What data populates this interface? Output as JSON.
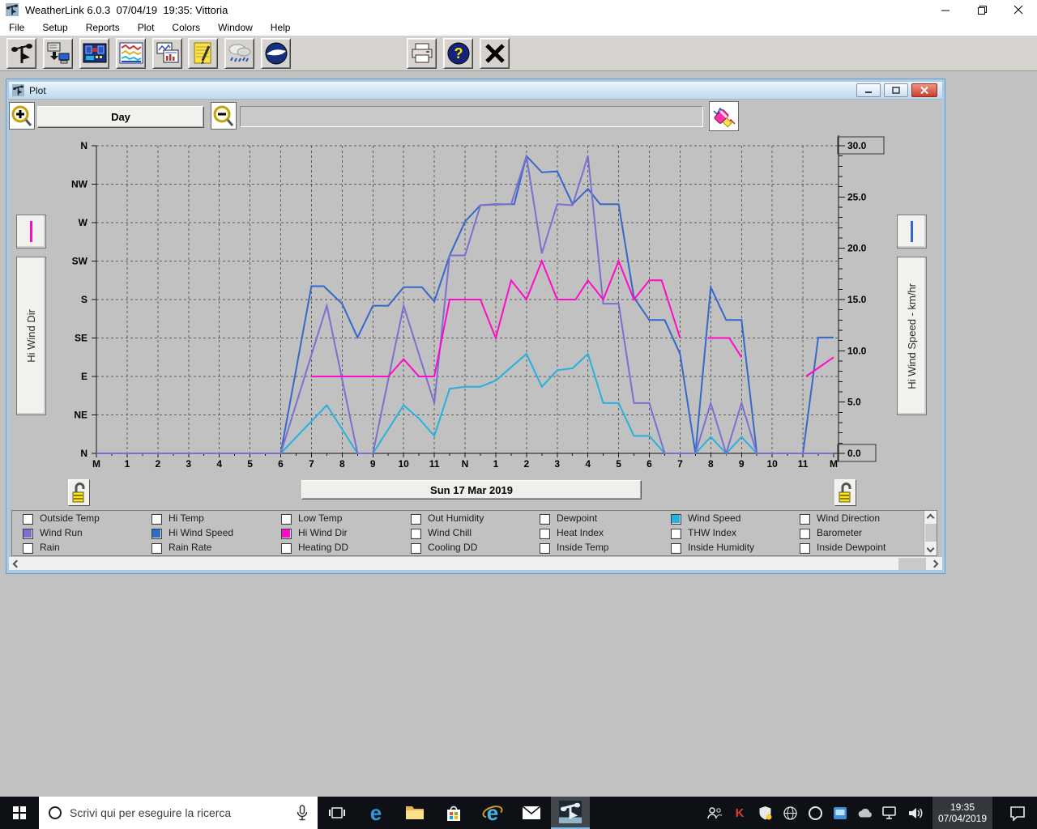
{
  "app": {
    "title": "WeatherLink 6.0.3  07/04/19  19:35: Vittoria",
    "menu": [
      "File",
      "Setup",
      "Reports",
      "Plot",
      "Colors",
      "Window",
      "Help"
    ]
  },
  "toolbar": {
    "icons": [
      "station",
      "download",
      "bulletin",
      "plot",
      "strip-charts",
      "notes",
      "rain",
      "noaa",
      "print",
      "help",
      "close"
    ],
    "help_glyph": "?"
  },
  "plot_window": {
    "title": "Plot",
    "range_button": "Day",
    "date_button": "Sun 17 Mar 2019",
    "left_axis_panel": "Hi Wind Dir",
    "right_axis_panel": "Hi Wind Speed - km/hr"
  },
  "chart_data": {
    "type": "line",
    "title": "Day plot - Sun 17 Mar 2019",
    "grid": "dashed",
    "x": {
      "unit": "hour",
      "min": 0,
      "max": 24,
      "tick_labels": [
        "M",
        "1",
        "2",
        "3",
        "4",
        "5",
        "6",
        "7",
        "8",
        "9",
        "10",
        "11",
        "N",
        "1",
        "2",
        "3",
        "4",
        "5",
        "6",
        "7",
        "8",
        "9",
        "10",
        "11",
        "M"
      ]
    },
    "left_axis": {
      "title": "Hi Wind Dir",
      "labels_bottom_to_top": [
        "N",
        "NE",
        "E",
        "SE",
        "S",
        "SW",
        "W",
        "NW",
        "N"
      ]
    },
    "right_axis": {
      "title": "Hi Wind Speed - km/hr",
      "min": 0,
      "max": 30,
      "major_step": 5,
      "labels": [
        "0.0",
        "5.0",
        "10.0",
        "15.0",
        "20.0",
        "25.0",
        "30.0"
      ],
      "boxed_labels": [
        "30.0",
        "0.0"
      ]
    },
    "series": [
      {
        "name": "Hi Wind Speed",
        "axis": "right",
        "color": "#3568c8",
        "segments": [
          [
            [
              0,
              0
            ],
            [
              6,
              0
            ],
            [
              7,
              16.3
            ],
            [
              7.4,
              16.3
            ],
            [
              8,
              14.6
            ],
            [
              8.5,
              11.3
            ],
            [
              9,
              14.4
            ],
            [
              9.5,
              14.4
            ],
            [
              10,
              16.2
            ],
            [
              10.6,
              16.2
            ],
            [
              11,
              14.8
            ],
            [
              11.5,
              19.3
            ],
            [
              12,
              22.6
            ],
            [
              12.5,
              24.2
            ],
            [
              13,
              24.3
            ],
            [
              13.6,
              24.3
            ],
            [
              14,
              29
            ],
            [
              14.5,
              27.4
            ],
            [
              15,
              27.5
            ],
            [
              15.5,
              24.3
            ],
            [
              16,
              25.8
            ],
            [
              16.4,
              24.3
            ],
            [
              17,
              24.3
            ],
            [
              17.5,
              15.2
            ],
            [
              18,
              13
            ],
            [
              18.5,
              13
            ],
            [
              19,
              9.7
            ],
            [
              19.5,
              0
            ],
            [
              20,
              16.2
            ],
            [
              20.5,
              13
            ],
            [
              21,
              13
            ],
            [
              21.5,
              0
            ],
            [
              23,
              0
            ],
            [
              23.5,
              11.3
            ],
            [
              24,
              11.3
            ]
          ]
        ]
      },
      {
        "name": "Wind Speed",
        "axis": "right",
        "color": "#25b2e0",
        "segments": [
          [
            [
              0,
              0
            ],
            [
              6,
              0
            ],
            [
              7.5,
              4.7
            ],
            [
              8.5,
              0
            ],
            [
              9,
              0
            ],
            [
              10,
              4.7
            ],
            [
              10.5,
              3.4
            ],
            [
              11,
              1.7
            ],
            [
              11.5,
              6.3
            ],
            [
              12,
              6.5
            ],
            [
              12.5,
              6.5
            ],
            [
              13,
              7.1
            ],
            [
              14,
              9.7
            ],
            [
              14.5,
              6.5
            ],
            [
              15,
              8.1
            ],
            [
              15.5,
              8.3
            ],
            [
              16,
              9.7
            ],
            [
              16.5,
              4.9
            ],
            [
              17,
              4.9
            ],
            [
              17.5,
              1.7
            ],
            [
              18,
              1.7
            ],
            [
              18.5,
              0
            ],
            [
              19.5,
              0
            ],
            [
              20,
              1.6
            ],
            [
              20.5,
              0
            ],
            [
              21,
              1.6
            ],
            [
              21.5,
              0
            ],
            [
              24,
              0
            ]
          ]
        ]
      },
      {
        "name": "Wind Run",
        "axis": "right",
        "color": "#7b6fd0",
        "segments": [
          [
            [
              0,
              0
            ],
            [
              6,
              0
            ],
            [
              7.5,
              14.4
            ],
            [
              8.5,
              0
            ],
            [
              9,
              0
            ],
            [
              10,
              14.4
            ],
            [
              11,
              4.9
            ],
            [
              11.5,
              19.3
            ],
            [
              12,
              19.3
            ],
            [
              12.5,
              24.2
            ],
            [
              13.5,
              24.3
            ],
            [
              14,
              29
            ],
            [
              14.5,
              19.5
            ],
            [
              15,
              24.3
            ],
            [
              15.5,
              24.2
            ],
            [
              16,
              29
            ],
            [
              16.5,
              14.6
            ],
            [
              17,
              14.6
            ],
            [
              17.5,
              4.9
            ],
            [
              18,
              4.9
            ],
            [
              18.5,
              0
            ],
            [
              19.5,
              0
            ],
            [
              20,
              4.9
            ],
            [
              20.5,
              0
            ],
            [
              21,
              4.9
            ],
            [
              21.5,
              0
            ],
            [
              24,
              0
            ]
          ]
        ]
      },
      {
        "name": "Hi Wind Dir",
        "axis": "compass",
        "color": "#ff0ac8",
        "segments": [
          [
            [
              7,
              2
            ],
            [
              9.5,
              2
            ],
            [
              10,
              2.45
            ],
            [
              10.5,
              2
            ],
            [
              11,
              2
            ],
            [
              11.5,
              4
            ],
            [
              12.5,
              4
            ],
            [
              13,
              3
            ],
            [
              13.5,
              4.5
            ],
            [
              14,
              4
            ],
            [
              14.5,
              5
            ],
            [
              15,
              4
            ],
            [
              15.6,
              4
            ],
            [
              16,
              4.5
            ],
            [
              16.5,
              4
            ],
            [
              17,
              5
            ],
            [
              17.5,
              4
            ],
            [
              18,
              4.5
            ],
            [
              18.4,
              4.5
            ],
            [
              19,
              3
            ]
          ],
          [
            [
              19.9,
              3
            ],
            [
              20.6,
              3
            ],
            [
              21,
              2.5
            ]
          ],
          [
            [
              23.1,
              2
            ],
            [
              24,
              2.5
            ]
          ]
        ]
      }
    ]
  },
  "legend": {
    "columns": [
      [
        {
          "label": "Outside Temp",
          "color": null
        },
        {
          "label": "Wind Run",
          "color": "#7b6fd0"
        },
        {
          "label": "Rain",
          "color": null
        }
      ],
      [
        {
          "label": "Hi Temp",
          "color": null
        },
        {
          "label": "Hi Wind Speed",
          "color": "#2f6bc8"
        },
        {
          "label": "Rain Rate",
          "color": null
        }
      ],
      [
        {
          "label": "Low Temp",
          "color": null
        },
        {
          "label": "Hi Wind Dir",
          "color": "#ff0ac8"
        },
        {
          "label": "Heating DD",
          "color": null
        }
      ],
      [
        {
          "label": "Out Humidity",
          "color": null
        },
        {
          "label": "Wind Chill",
          "color": null
        },
        {
          "label": "Cooling DD",
          "color": null
        }
      ],
      [
        {
          "label": "Dewpoint",
          "color": null
        },
        {
          "label": "Heat Index",
          "color": null
        },
        {
          "label": "Inside Temp",
          "color": null
        }
      ],
      [
        {
          "label": "Wind Speed",
          "color": "#25b2e0"
        },
        {
          "label": "THW Index",
          "color": null
        },
        {
          "label": "Inside Humidity",
          "color": null
        }
      ],
      [
        {
          "label": "Wind Direction",
          "color": null
        },
        {
          "label": "Barometer",
          "color": null
        },
        {
          "label": "Inside Dewpoint",
          "color": null
        }
      ]
    ]
  },
  "taskbar": {
    "search_placeholder": "Scrivi qui per eseguire la ricerca",
    "edge_glyph": "e",
    "ie_glyph": "e",
    "kaspersky_glyph": "K",
    "clock": {
      "time": "19:35",
      "date": "07/04/2019"
    }
  }
}
